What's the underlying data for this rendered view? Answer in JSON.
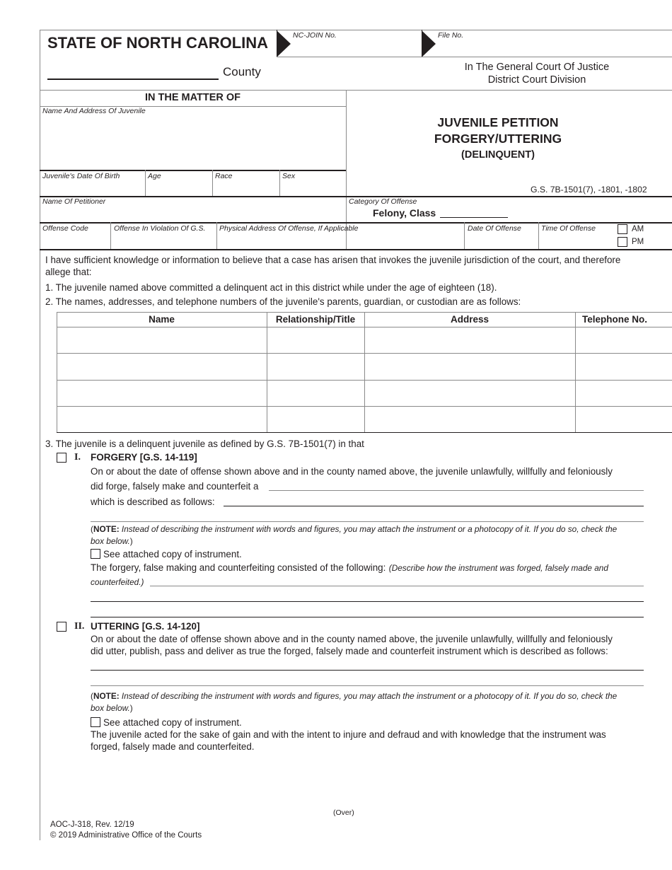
{
  "header": {
    "state": "STATE OF NORTH CAROLINA",
    "nc_join_label": "NC-JOIN No.",
    "file_no_label": "File No.",
    "county_label": "County",
    "court_line1": "In The General Court Of Justice",
    "court_line2": "District Court Division"
  },
  "matter": {
    "heading": "IN THE MATTER OF",
    "name_address_label": "Name And Address Of Juvenile",
    "dob_label": "Juvenile's Date Of Birth",
    "age_label": "Age",
    "race_label": "Race",
    "sex_label": "Sex",
    "petitioner_label": "Name Of Petitioner",
    "offense_code_label": "Offense Code",
    "offense_violation_label": "Offense In Violation Of G.S.",
    "physical_address_label": "Physical Address Of Offense, If Applicable",
    "date_of_offense_label": "Date Of Offense",
    "time_of_offense_label": "Time Of Offense",
    "am_label": "AM",
    "pm_label": "PM"
  },
  "title": {
    "line1": "JUVENILE PETITION",
    "line2": "FORGERY/UTTERING",
    "line3": "(DELINQUENT)",
    "statute": "G.S. 7B-1501(7), -1801, -1802",
    "category_label": "Category Of Offense",
    "felony_class": "Felony, Class"
  },
  "body": {
    "intro_line1": "I have sufficient knowledge or information to believe that a case has arisen that invokes the juvenile jurisdiction of the court, and therefore",
    "intro_line2": "allege that:",
    "item1": "1. The juvenile named above committed a delinquent act in this district while under the age of eighteen (18).",
    "item2": "2. The names, addresses, and telephone numbers of the juvenile's parents, guardian, or custodian are as follows:",
    "item3": "3. The juvenile is a delinquent juvenile as defined by G.S. 7B-1501(7) in that"
  },
  "parents_table": {
    "headers": [
      "Name",
      "Relationship/Title",
      "Address",
      "Telephone No."
    ],
    "rows": [
      [
        "",
        "",
        "",
        ""
      ],
      [
        "",
        "",
        "",
        ""
      ],
      [
        "",
        "",
        "",
        ""
      ],
      [
        "",
        "",
        "",
        ""
      ]
    ]
  },
  "forgery": {
    "numeral": "I.",
    "heading": "FORGERY [G.S. 14-119]",
    "line1": "On or about the date of offense shown above and in the county named above, the juvenile unlawfully, willfully and feloniously",
    "line2": "did forge, falsely make and counterfeit a",
    "line3": "which is described as follows:",
    "note_bold": "NOTE:",
    "note_italic": "Instead of describing the instrument with words and figures, you may attach the instrument or a photocopy of it. If you do so, check the",
    "note_italic2": "box below.",
    "attached_label": "See attached copy of instrument.",
    "consisted_text": "The forgery, false making and counterfeiting consisted of the following:",
    "consisted_italic": "(Describe how the instrument was forged, falsely made and",
    "consisted_italic2": "counterfeited.)"
  },
  "uttering": {
    "numeral": "II.",
    "heading": "UTTERING [G.S. 14-120]",
    "line1": "On or about the date of offense shown above and in the county named above, the juvenile unlawfully, willfully and feloniously",
    "line2": "did utter, publish, pass and deliver as true the forged, falsely made and counterfeit instrument which is described as follows:",
    "note_bold": "NOTE:",
    "note_italic": "Instead of describing the instrument with words and figures, you may attach the instrument or a photocopy of it. If you do so, check the",
    "note_italic2": "box below.",
    "attached_label": "See attached copy of instrument.",
    "gain_line1": "The juvenile acted for the sake of gain and with the intent to injure and defraud and with knowledge that the instrument was",
    "gain_line2": "forged, falsely made and counterfeited."
  },
  "footer": {
    "over": "(Over)",
    "form_id": "AOC-J-318, Rev. 12/19",
    "copyright": "© 2019 Administrative Office of the Courts"
  }
}
